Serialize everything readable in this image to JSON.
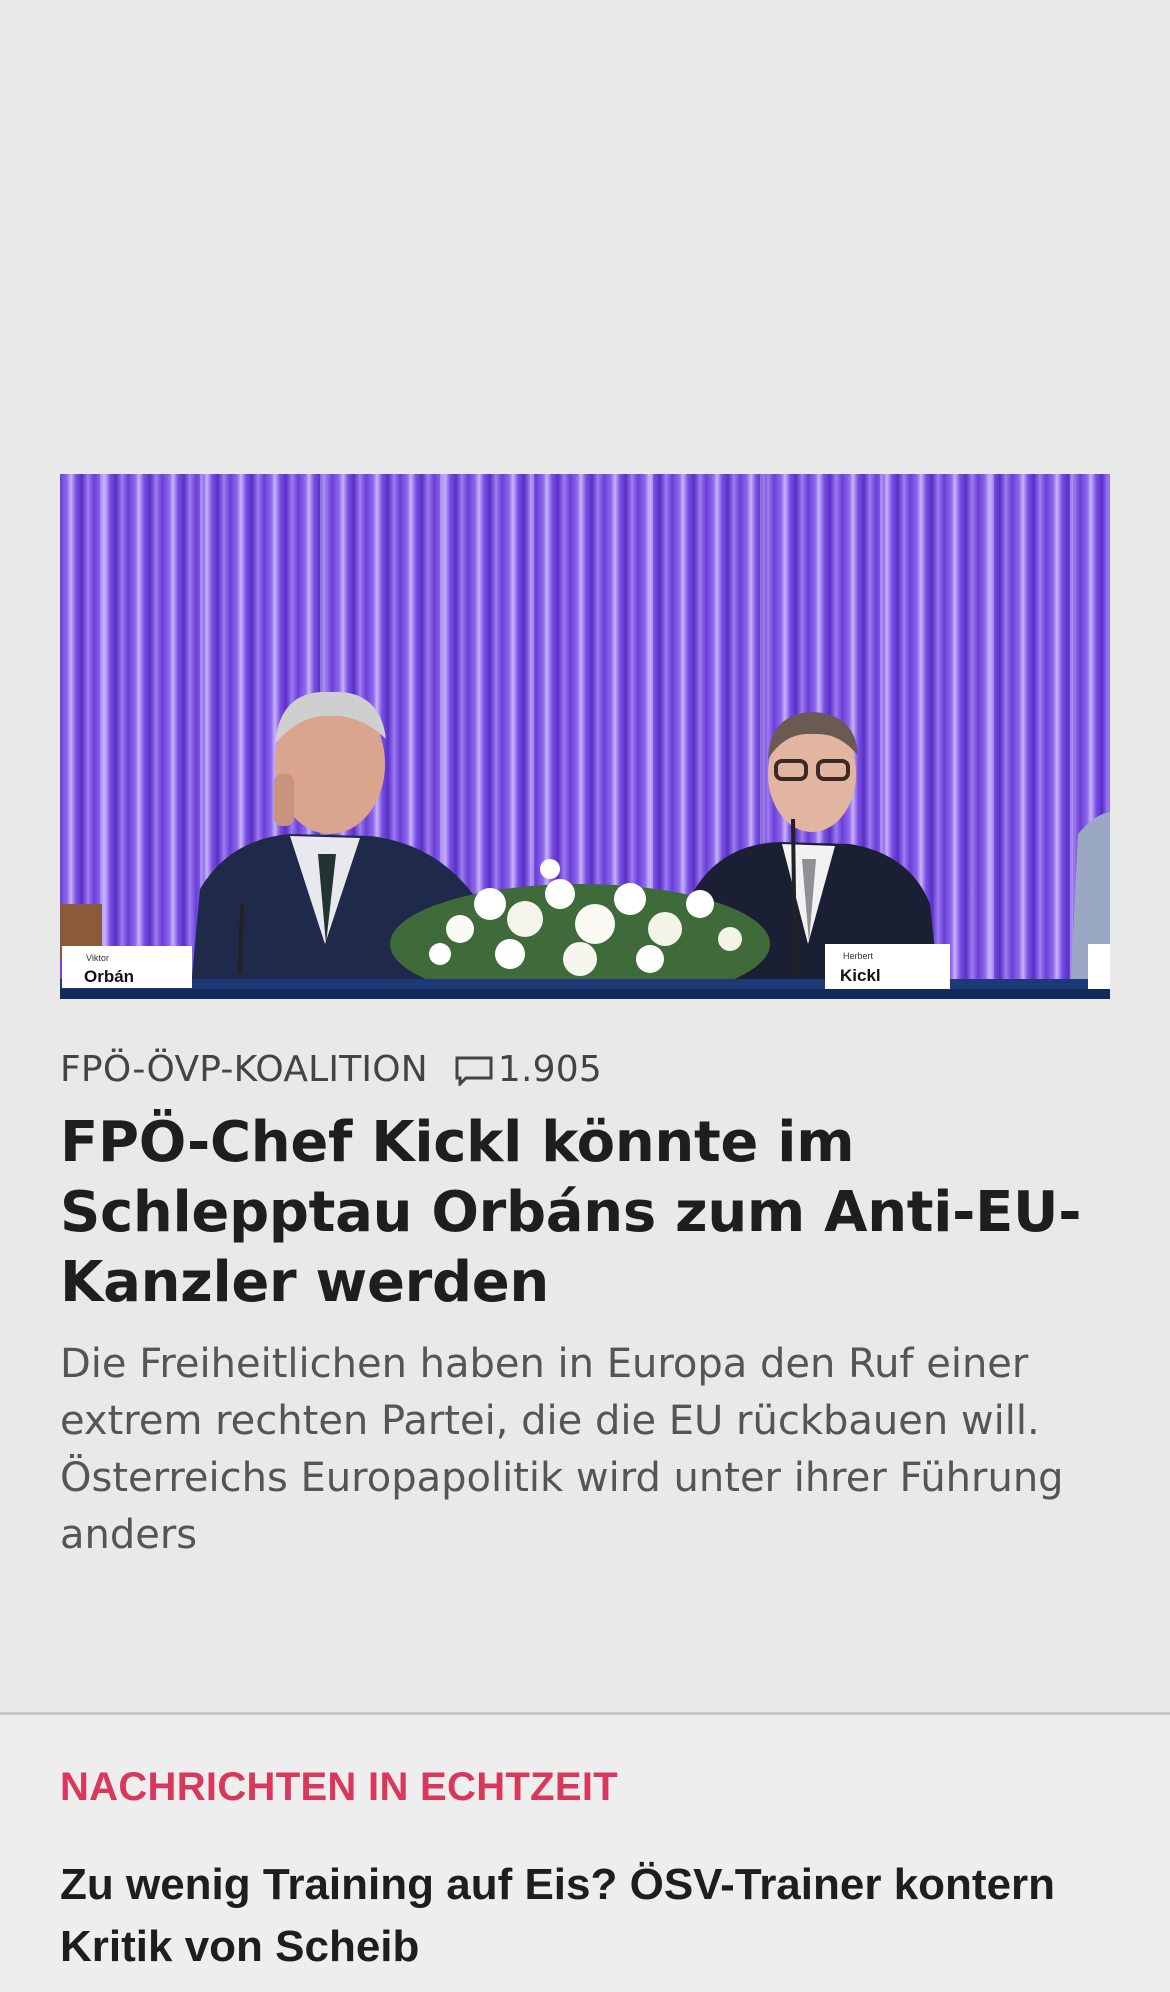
{
  "article": {
    "category": "FPÖ-ÖVP-KOALITION",
    "comment_count": "1.905",
    "headline": "FPÖ-Chef Kickl könnte im Schlepptau Orbáns zum Anti-EU-Kanzler werden",
    "teaser": "Die Freiheitlichen haben in Europa den Ruf einer extrem rechten Partei, die die EU rückbauen will. Österreichs Europapolitik wird unter ihrer Führung anders",
    "photo": {
      "name_card_left_small": "Viktor",
      "name_card_left": "Orbán",
      "name_card_right_small": "Herbert",
      "name_card_right": "Kickl"
    }
  },
  "live": {
    "section_title": "NACHRICHTEN IN ECHTZEIT",
    "headline": "Zu wenig Training auf Eis? ÖSV-Trainer kontern Kritik von Scheib"
  },
  "icons": {
    "comment": "comment-icon"
  },
  "colors": {
    "accent": "#d8385b",
    "background": "#e9e9e9"
  }
}
